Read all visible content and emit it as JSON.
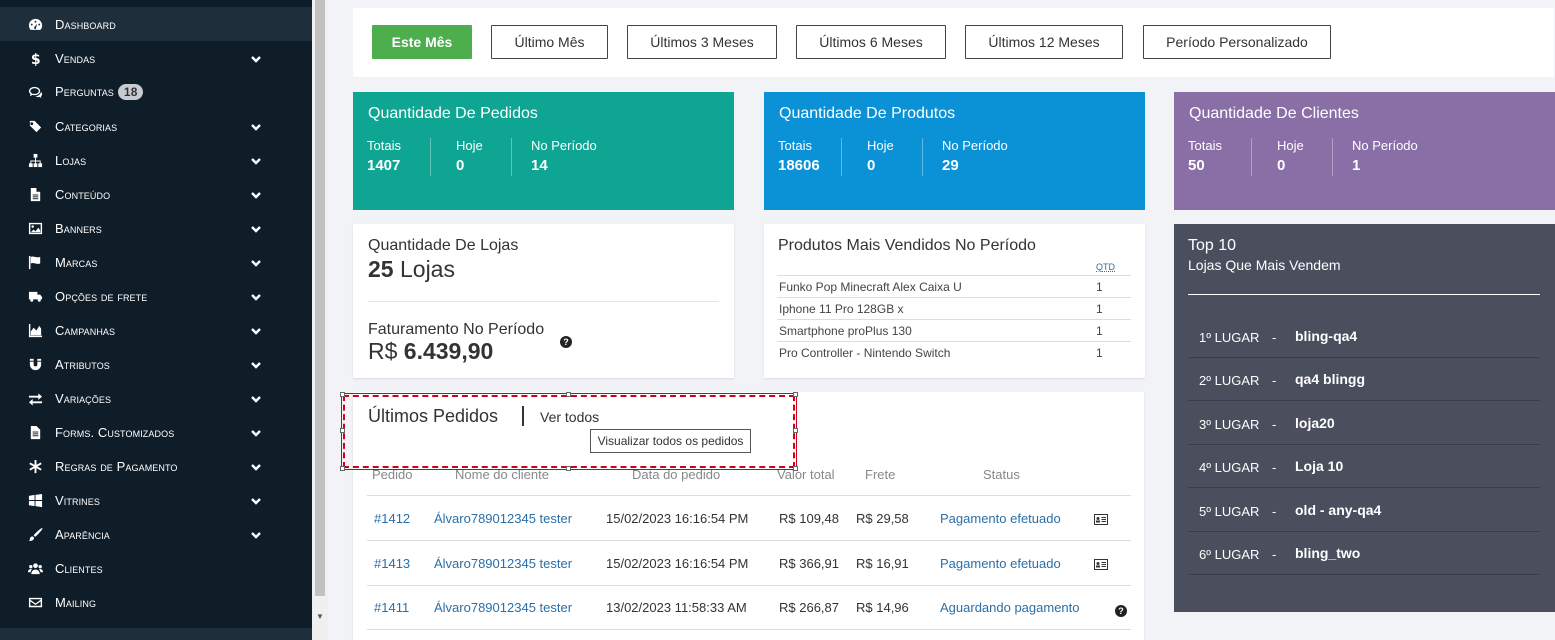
{
  "sidebar": {
    "items": [
      {
        "label": "Dashboard",
        "icon": "dashboard-icon",
        "chevron": false,
        "active": true
      },
      {
        "label": "Vendas",
        "icon": "dollar-icon",
        "chevron": true
      },
      {
        "label": "Perguntas",
        "icon": "comments-icon",
        "chevron": false,
        "badge": "18"
      },
      {
        "label": "Categorias",
        "icon": "tags-icon",
        "chevron": true
      },
      {
        "label": "Lojas",
        "icon": "sitemap-icon",
        "chevron": true
      },
      {
        "label": "Conteúdo",
        "icon": "file-icon",
        "chevron": true
      },
      {
        "label": "Banners",
        "icon": "image-icon",
        "chevron": true
      },
      {
        "label": "Marcas",
        "icon": "flag-icon",
        "chevron": true
      },
      {
        "label": "Opções de frete",
        "icon": "truck-icon",
        "chevron": true
      },
      {
        "label": "Campanhas",
        "icon": "area-chart-icon",
        "chevron": true
      },
      {
        "label": "Atributos",
        "icon": "magnet-icon",
        "chevron": true
      },
      {
        "label": "Variações",
        "icon": "exchange-icon",
        "chevron": true
      },
      {
        "label": "Forms. Customizados",
        "icon": "file-text-icon",
        "chevron": true
      },
      {
        "label": "Regras de Pagamento",
        "icon": "asterisk-icon",
        "chevron": true
      },
      {
        "label": "Vitrines",
        "icon": "windows-icon",
        "chevron": true
      },
      {
        "label": "Aparência",
        "icon": "paint-brush-icon",
        "chevron": true
      },
      {
        "label": "Clientes",
        "icon": "users-icon",
        "chevron": false
      },
      {
        "label": "Mailing",
        "icon": "envelope-icon",
        "chevron": false
      }
    ]
  },
  "period": {
    "buttons": [
      {
        "label": "Este Mês",
        "active": true
      },
      {
        "label": "Último Mês"
      },
      {
        "label": "Últimos 3 Meses"
      },
      {
        "label": "Últimos 6 Meses"
      },
      {
        "label": "Últimos 12 Meses"
      },
      {
        "label": "Período Personalizado"
      }
    ]
  },
  "stats": [
    {
      "title": "Quantidade De Pedidos",
      "color": "#0ea593",
      "totais_label": "Totais",
      "totais": "1407",
      "hoje_label": "Hoje",
      "hoje": "0",
      "periodo_label": "No Período",
      "periodo": "14"
    },
    {
      "title": "Quantidade De Produtos",
      "color": "#0a91d6",
      "totais_label": "Totais",
      "totais": "18606",
      "hoje_label": "Hoje",
      "hoje": "0",
      "periodo_label": "No Período",
      "periodo": "29"
    },
    {
      "title": "Quantidade De Clientes",
      "color": "#8a6ea6",
      "totais_label": "Totais",
      "totais": "50",
      "hoje_label": "Hoje",
      "hoje": "0",
      "periodo_label": "No Período",
      "periodo": "1"
    }
  ],
  "lojas": {
    "title": "Quantidade De Lojas",
    "count": "25",
    "unit": " Lojas",
    "fat_title": "Faturamento No Período",
    "fat_currency": "R$ ",
    "fat_value": "6.439,90"
  },
  "mais_vendidos": {
    "title": "Produtos Mais Vendidos No Período",
    "qtd_label": "QTD",
    "rows": [
      {
        "name": "Funko Pop Minecraft Alex Caixa U",
        "qtd": "1"
      },
      {
        "name": "Iphone 11 Pro 128GB x",
        "qtd": "1"
      },
      {
        "name": "Smartphone proPlus 130",
        "qtd": "1"
      },
      {
        "name": "Pro Controller - Nintendo Switch",
        "qtd": "1"
      }
    ]
  },
  "top10": {
    "title": "Top 10",
    "subtitle": "Lojas Que Mais Vendem",
    "dash": "-",
    "rows": [
      {
        "pos": "1º LUGAR",
        "name": "bling-qa4"
      },
      {
        "pos": "2º LUGAR",
        "name": "qa4 blingg"
      },
      {
        "pos": "3º LUGAR",
        "name": "loja20"
      },
      {
        "pos": "4º LUGAR",
        "name": "Loja 10"
      },
      {
        "pos": "5º LUGAR",
        "name": "old - any-qa4"
      },
      {
        "pos": "6º LUGAR",
        "name": "bling_two"
      }
    ]
  },
  "orders": {
    "title": "Últimos Pedidos",
    "link": "Ver todos",
    "tooltip": "Visualizar todos os pedidos",
    "headers": [
      "Pedido",
      "Nome do cliente",
      "Data do pedido",
      "Valor total",
      "Frete",
      "Status"
    ],
    "rows": [
      {
        "id": "#1412",
        "client": "Álvaro789012345 tester",
        "date": "15/02/2023 16:16:54 PM",
        "total": "R$ 109,48",
        "frete": "R$ 29,58",
        "status": "Pagamento efetuado",
        "icon": "id-card-icon"
      },
      {
        "id": "#1413",
        "client": "Álvaro789012345 tester",
        "date": "15/02/2023 16:16:54 PM",
        "total": "R$ 366,91",
        "frete": "R$ 16,91",
        "status": "Pagamento efetuado",
        "icon": "id-card-icon"
      },
      {
        "id": "#1411",
        "client": "Álvaro789012345 tester",
        "date": "13/02/2023 11:58:33 AM",
        "total": "R$ 266,87",
        "frete": "R$ 14,96",
        "status": "Aguardando pagamento",
        "icon": "question-circle-icon"
      }
    ]
  }
}
